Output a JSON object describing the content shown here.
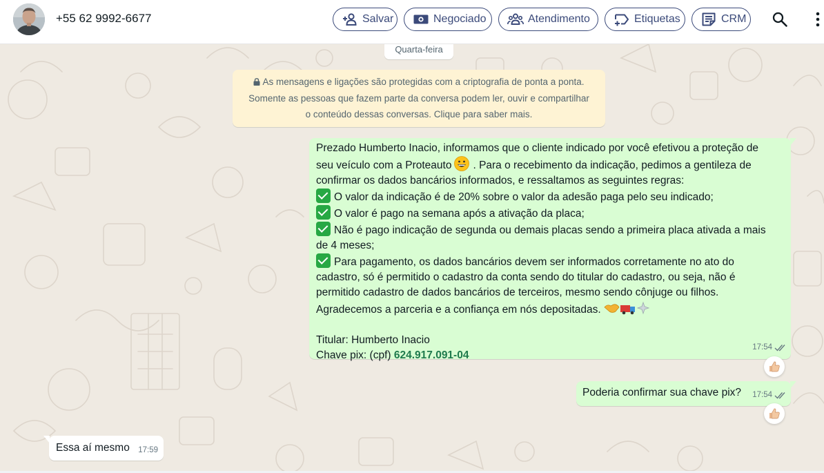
{
  "header": {
    "contact_name": "+55 62 9992-6677",
    "buttons": [
      {
        "label": "Salvar",
        "icon": "add-person-icon"
      },
      {
        "label": "Negociado",
        "icon": "money-icon"
      },
      {
        "label": "Atendimento",
        "icon": "people-icon"
      },
      {
        "label": "Etiquetas",
        "icon": "label-icon"
      },
      {
        "label": "CRM",
        "icon": "notes-icon"
      }
    ],
    "search_icon": "search-icon",
    "menu_icon": "more-vertical-icon",
    "accent_color": "#3b4a7a"
  },
  "chat": {
    "date_separator": "Quarta-feira",
    "encryption_notice": {
      "line1": "As mensagens e ligações são protegidas com a criptografia de ponta a ponta.",
      "line2": "Somente as pessoas que fazem parte da conversa podem ler, ouvir e compartilhar",
      "line3": "o conteúdo dessas conversas. Clique para saber mais."
    },
    "messages": [
      {
        "direction": "outgoing",
        "lines": {
          "intro_a": "Prezado Humberto Inacio, informamos que o cliente indicado por você efetivou a proteção de",
          "intro_b": "seu veículo com a Proteauto",
          "intro_c": ". Para o recebimento da indicação, pedimos a gentileza de",
          "intro_d": "confirmar os dados bancários informados, e  ressaltamos as seguintes regras:",
          "rule1": "O valor da indicação é de 20% sobre o valor da adesão paga pelo seu indicado;",
          "rule2": "O valor é pago na semana após a ativação da placa;",
          "rule3a": "Não é pago indicação de segunda ou demais placas sendo a primeira placa ativada a mais",
          "rule3b": "de 4 meses;",
          "rule4a": "Para pagamento, os dados bancários devem ser informados corretamente no ato do",
          "rule4b": "cadastro, só é permitido o cadastro da conta sendo do titular do cadastro, ou seja, não é",
          "rule4c": "permitido cadastro de dados bancários de terceiros, mesmo sendo cônjuge ou filhos.",
          "thanks": "Agradecemos a parceria e a confiança em nós depositadas.",
          "holder": "Titular: Humberto Inacio",
          "pix_label": "Chave pix: (cpf) ",
          "pix_key": "624.917.091-04"
        },
        "time": "17:54",
        "status": "read",
        "reaction": "thumbs-up"
      },
      {
        "direction": "outgoing",
        "text": "Poderia confirmar sua chave pix?",
        "time": "17:54",
        "status": "read",
        "reaction": "thumbs-up"
      },
      {
        "direction": "incoming",
        "text": "Essa aí mesmo",
        "time": "17:59"
      }
    ],
    "colors": {
      "background": "#efeae2",
      "outgoing_bubble": "#d9fdd3",
      "incoming_bubble": "#ffffff",
      "encryption_bubble": "#fef3d4",
      "pix_key": "#1f7a4d"
    }
  }
}
